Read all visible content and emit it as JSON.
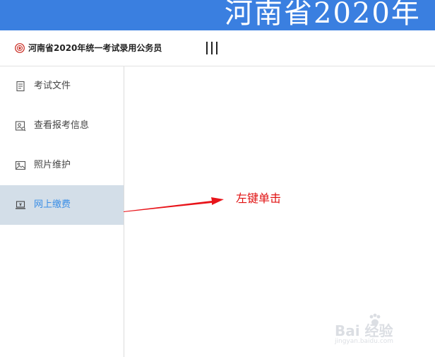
{
  "banner": {
    "title": "河南省2020年"
  },
  "header": {
    "site_name": "河南省2020年统一考试录用公务员"
  },
  "sidebar": {
    "items": [
      {
        "label": "考试文件",
        "icon": "document-icon",
        "active": false
      },
      {
        "label": "查看报考信息",
        "icon": "profile-search-icon",
        "active": false
      },
      {
        "label": "照片维护",
        "icon": "image-icon",
        "active": false
      },
      {
        "label": "网上缴费",
        "icon": "laptop-payment-icon",
        "active": true
      }
    ]
  },
  "annotation": {
    "text": "左键单击"
  },
  "watermark": {
    "main": "Bai 经验",
    "sub": "jingyan.baidu.com"
  },
  "colors": {
    "banner": "#3a7fe0",
    "active_bg": "#d3dee8",
    "active_text": "#3a8ee6",
    "annotation": "#e01010"
  }
}
